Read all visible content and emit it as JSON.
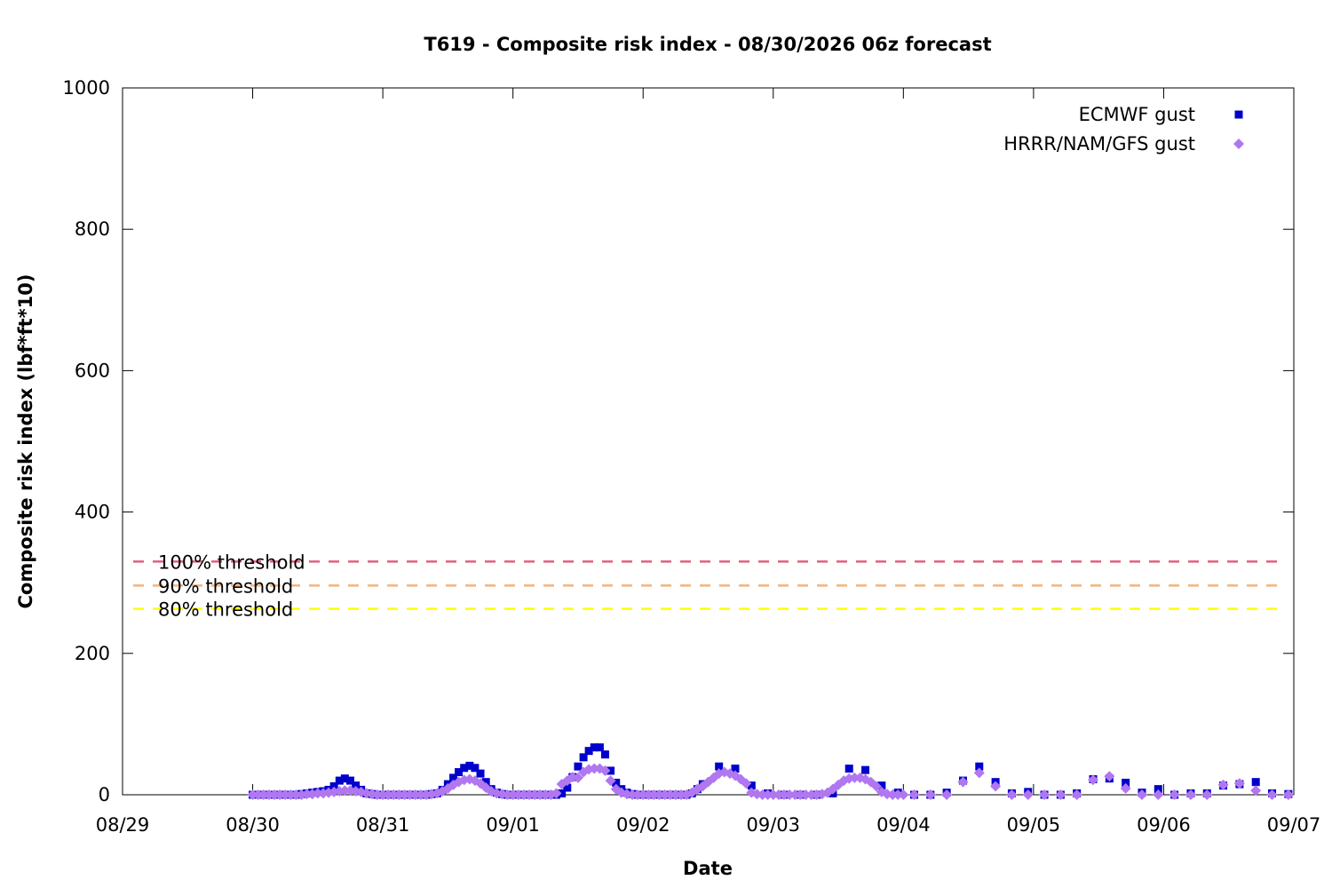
{
  "chart_data": {
    "type": "scatter",
    "title": "T619 - Composite risk index - 08/30/2026 06z forecast",
    "xlabel": "Date",
    "ylabel": "Composite risk index (lbf*ft*10)",
    "ylim": [
      0,
      1000
    ],
    "yticks": [
      "0",
      "200",
      "400",
      "600",
      "800",
      "1000"
    ],
    "xlim": [
      0,
      8
    ],
    "xtick_labels": [
      "08/29",
      "08/30",
      "08/31",
      "09/01",
      "09/02",
      "09/03",
      "09/04",
      "09/05",
      "09/06",
      "09/07"
    ],
    "grid": false,
    "legend_position": "top-right",
    "thresholds": [
      {
        "label": "100% threshold",
        "value": 330,
        "color": "#e0607e"
      },
      {
        "label": "90% threshold",
        "value": 296,
        "color": "#f4b27c"
      },
      {
        "label": "80% threshold",
        "value": 263,
        "color": "#ffff00"
      }
    ],
    "series": [
      {
        "name": "ECMWF gust",
        "marker": "square",
        "color": "#0000cc",
        "points": [
          [
            1.0,
            0
          ],
          [
            1.042,
            0
          ],
          [
            1.083,
            0
          ],
          [
            1.125,
            0
          ],
          [
            1.167,
            0
          ],
          [
            1.208,
            0
          ],
          [
            1.25,
            0
          ],
          [
            1.292,
            0
          ],
          [
            1.333,
            0
          ],
          [
            1.375,
            1
          ],
          [
            1.417,
            2
          ],
          [
            1.458,
            3
          ],
          [
            1.5,
            4
          ],
          [
            1.542,
            5
          ],
          [
            1.583,
            7
          ],
          [
            1.625,
            12
          ],
          [
            1.667,
            20
          ],
          [
            1.708,
            23
          ],
          [
            1.75,
            20
          ],
          [
            1.792,
            13
          ],
          [
            1.833,
            7
          ],
          [
            1.875,
            2
          ],
          [
            1.917,
            1
          ],
          [
            1.958,
            0
          ],
          [
            2.0,
            0
          ],
          [
            2.042,
            0
          ],
          [
            2.083,
            0
          ],
          [
            2.125,
            0
          ],
          [
            2.167,
            0
          ],
          [
            2.208,
            0
          ],
          [
            2.25,
            0
          ],
          [
            2.292,
            0
          ],
          [
            2.333,
            0
          ],
          [
            2.375,
            1
          ],
          [
            2.417,
            2
          ],
          [
            2.458,
            7
          ],
          [
            2.5,
            15
          ],
          [
            2.542,
            24
          ],
          [
            2.583,
            32
          ],
          [
            2.625,
            38
          ],
          [
            2.667,
            41
          ],
          [
            2.708,
            38
          ],
          [
            2.75,
            30
          ],
          [
            2.792,
            18
          ],
          [
            2.833,
            8
          ],
          [
            2.875,
            3
          ],
          [
            2.917,
            1
          ],
          [
            2.958,
            0
          ],
          [
            3.0,
            0
          ],
          [
            3.042,
            0
          ],
          [
            3.083,
            0
          ],
          [
            3.125,
            0
          ],
          [
            3.167,
            0
          ],
          [
            3.208,
            0
          ],
          [
            3.25,
            0
          ],
          [
            3.292,
            0
          ],
          [
            3.333,
            0
          ],
          [
            3.375,
            2
          ],
          [
            3.417,
            10
          ],
          [
            3.458,
            25
          ],
          [
            3.5,
            40
          ],
          [
            3.542,
            53
          ],
          [
            3.583,
            62
          ],
          [
            3.625,
            67
          ],
          [
            3.667,
            67
          ],
          [
            3.708,
            57
          ],
          [
            3.75,
            34
          ],
          [
            3.792,
            17
          ],
          [
            3.833,
            8
          ],
          [
            3.875,
            3
          ],
          [
            3.917,
            1
          ],
          [
            3.958,
            0
          ],
          [
            4.0,
            0
          ],
          [
            4.042,
            0
          ],
          [
            4.083,
            0
          ],
          [
            4.125,
            0
          ],
          [
            4.167,
            0
          ],
          [
            4.208,
            0
          ],
          [
            4.25,
            0
          ],
          [
            4.292,
            0
          ],
          [
            4.333,
            0
          ],
          [
            4.375,
            2
          ],
          [
            4.417,
            8
          ],
          [
            4.458,
            15
          ],
          [
            4.583,
            40
          ],
          [
            4.708,
            37
          ],
          [
            4.833,
            13
          ],
          [
            4.958,
            2
          ],
          [
            5.083,
            0
          ],
          [
            5.208,
            0
          ],
          [
            5.333,
            0
          ],
          [
            5.458,
            2
          ],
          [
            5.583,
            37
          ],
          [
            5.708,
            35
          ],
          [
            5.833,
            13
          ],
          [
            5.958,
            3
          ],
          [
            6.083,
            0
          ],
          [
            6.208,
            0
          ],
          [
            6.333,
            3
          ],
          [
            6.458,
            20
          ],
          [
            6.583,
            40
          ],
          [
            6.708,
            18
          ],
          [
            6.833,
            2
          ],
          [
            6.958,
            4
          ],
          [
            7.083,
            0
          ],
          [
            7.208,
            0
          ],
          [
            7.333,
            2
          ],
          [
            7.458,
            22
          ],
          [
            7.583,
            23
          ],
          [
            7.708,
            17
          ],
          [
            7.833,
            3
          ],
          [
            7.958,
            8
          ],
          [
            8.083,
            0
          ],
          [
            8.208,
            2
          ],
          [
            8.333,
            2
          ],
          [
            8.458,
            13
          ],
          [
            8.583,
            15
          ],
          [
            8.708,
            18
          ],
          [
            8.833,
            2
          ],
          [
            8.958,
            1
          ]
        ]
      },
      {
        "name": "HRRR/NAM/GFS gust",
        "marker": "diamond",
        "color": "#b077f0",
        "points": [
          [
            1.0,
            0
          ],
          [
            1.042,
            0
          ],
          [
            1.083,
            0
          ],
          [
            1.125,
            0
          ],
          [
            1.167,
            0
          ],
          [
            1.208,
            0
          ],
          [
            1.25,
            0
          ],
          [
            1.292,
            0
          ],
          [
            1.333,
            0
          ],
          [
            1.375,
            0
          ],
          [
            1.417,
            1
          ],
          [
            1.458,
            1
          ],
          [
            1.5,
            2
          ],
          [
            1.542,
            2
          ],
          [
            1.583,
            3
          ],
          [
            1.625,
            4
          ],
          [
            1.667,
            5
          ],
          [
            1.708,
            6
          ],
          [
            1.75,
            6
          ],
          [
            1.792,
            5
          ],
          [
            1.833,
            4
          ],
          [
            1.875,
            2
          ],
          [
            1.917,
            1
          ],
          [
            1.958,
            0
          ],
          [
            2.0,
            0
          ],
          [
            2.042,
            0
          ],
          [
            2.083,
            0
          ],
          [
            2.125,
            0
          ],
          [
            2.167,
            0
          ],
          [
            2.208,
            0
          ],
          [
            2.25,
            0
          ],
          [
            2.292,
            0
          ],
          [
            2.333,
            0
          ],
          [
            2.375,
            1
          ],
          [
            2.417,
            2
          ],
          [
            2.458,
            5
          ],
          [
            2.5,
            9
          ],
          [
            2.542,
            14
          ],
          [
            2.583,
            18
          ],
          [
            2.625,
            21
          ],
          [
            2.667,
            22
          ],
          [
            2.708,
            20
          ],
          [
            2.75,
            16
          ],
          [
            2.792,
            10
          ],
          [
            2.833,
            5
          ],
          [
            2.875,
            2
          ],
          [
            2.917,
            1
          ],
          [
            2.958,
            0
          ],
          [
            3.0,
            0
          ],
          [
            3.042,
            0
          ],
          [
            3.083,
            0
          ],
          [
            3.125,
            0
          ],
          [
            3.167,
            0
          ],
          [
            3.208,
            0
          ],
          [
            3.25,
            0
          ],
          [
            3.292,
            0
          ],
          [
            3.333,
            2
          ],
          [
            3.375,
            15
          ],
          [
            3.417,
            20
          ],
          [
            3.458,
            25
          ],
          [
            3.5,
            24
          ],
          [
            3.542,
            32
          ],
          [
            3.583,
            36
          ],
          [
            3.625,
            37
          ],
          [
            3.667,
            37
          ],
          [
            3.708,
            34
          ],
          [
            3.75,
            20
          ],
          [
            3.792,
            8
          ],
          [
            3.833,
            3
          ],
          [
            3.875,
            1
          ],
          [
            3.917,
            0
          ],
          [
            3.958,
            0
          ],
          [
            4.0,
            0
          ],
          [
            4.042,
            0
          ],
          [
            4.083,
            0
          ],
          [
            4.125,
            0
          ],
          [
            4.167,
            0
          ],
          [
            4.208,
            0
          ],
          [
            4.25,
            0
          ],
          [
            4.292,
            0
          ],
          [
            4.333,
            0
          ],
          [
            4.375,
            3
          ],
          [
            4.417,
            8
          ],
          [
            4.458,
            12
          ],
          [
            4.5,
            18
          ],
          [
            4.542,
            24
          ],
          [
            4.583,
            30
          ],
          [
            4.625,
            32
          ],
          [
            4.667,
            30
          ],
          [
            4.708,
            27
          ],
          [
            4.75,
            22
          ],
          [
            4.792,
            16
          ],
          [
            4.833,
            3
          ],
          [
            4.875,
            1
          ],
          [
            4.917,
            0
          ],
          [
            4.958,
            0
          ],
          [
            5.0,
            0
          ],
          [
            5.042,
            0
          ],
          [
            5.083,
            0
          ],
          [
            5.125,
            0
          ],
          [
            5.167,
            0
          ],
          [
            5.208,
            0
          ],
          [
            5.25,
            0
          ],
          [
            5.292,
            0
          ],
          [
            5.333,
            0
          ],
          [
            5.375,
            1
          ],
          [
            5.417,
            3
          ],
          [
            5.458,
            8
          ],
          [
            5.5,
            14
          ],
          [
            5.542,
            20
          ],
          [
            5.583,
            23
          ],
          [
            5.625,
            24
          ],
          [
            5.667,
            24
          ],
          [
            5.708,
            22
          ],
          [
            5.75,
            18
          ],
          [
            5.792,
            12
          ],
          [
            5.833,
            4
          ],
          [
            5.875,
            1
          ],
          [
            5.917,
            0
          ],
          [
            5.958,
            0
          ],
          [
            6.0,
            0
          ],
          [
            6.083,
            0
          ],
          [
            6.208,
            0
          ],
          [
            6.333,
            0
          ],
          [
            6.458,
            18
          ],
          [
            6.583,
            31
          ],
          [
            6.708,
            12
          ],
          [
            6.833,
            0
          ],
          [
            6.958,
            0
          ],
          [
            7.083,
            0
          ],
          [
            7.208,
            0
          ],
          [
            7.333,
            0
          ],
          [
            7.458,
            21
          ],
          [
            7.583,
            26
          ],
          [
            7.708,
            9
          ],
          [
            7.833,
            0
          ],
          [
            7.958,
            0
          ],
          [
            8.083,
            0
          ],
          [
            8.208,
            0
          ],
          [
            8.333,
            0
          ],
          [
            8.458,
            14
          ],
          [
            8.583,
            16
          ],
          [
            8.708,
            6
          ],
          [
            8.833,
            0
          ],
          [
            8.958,
            0
          ]
        ]
      }
    ]
  }
}
